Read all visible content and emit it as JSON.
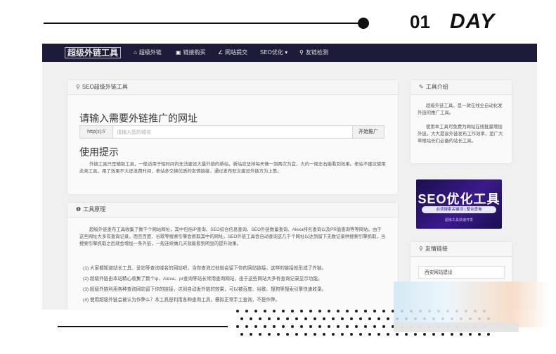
{
  "decor": {
    "number": "01",
    "day_label": "DAY"
  },
  "colors": {
    "navbar": "#1c1c3a",
    "banner": "#2a1670",
    "page_bg": "#f0f0f0"
  },
  "nav": {
    "brand": "超级外链工具",
    "items": [
      {
        "label": "超级外链",
        "icon": "home-icon"
      },
      {
        "label": "链接购买",
        "icon": "calendar-icon"
      },
      {
        "label": "网站提交",
        "icon": "chart-icon"
      },
      {
        "label": "SEO优化 ▾",
        "icon": ""
      },
      {
        "label": "友链检测",
        "icon": "link-icon"
      }
    ]
  },
  "main_panel": {
    "header": "SEO超级外链工具",
    "heading": "请输入需要外链推广的网址",
    "prefix": "http(s)://",
    "url_placeholder": "请输入您的域名",
    "submit_label": "开始推广",
    "tips_heading": "使用提示",
    "tips_text": "外链工具只是辅助工具，一般适用于短时间内无法建设大量外链的新站，新站应坚持每天做一到两次为宜，大约一周左右能看到效果。老站不建议使用此类工具，用了效果不大还浪费时间，老站多交换优质的友情链接，通过发布软文建设外链方为上策。"
  },
  "principle_panel": {
    "header": "工具原理",
    "intro": "超级外链发布工具收集了数千个网站网址，其中包括IP查询、SEO综合信息查询、SEO外链数量查询、Alexa排名查询以及PR值查询等等网站。由于这些网址大多有查询记录，而且百度、谷歌等搜索引擎会抓取其中的网址。SEO外链工具会自动查询这几千个网址以达到留下无数记录供搜索引擎抓取，当搜索引擎抓取之后就会增加一条外链，一般连续做几天就能看到明显的提升效果。",
    "items": [
      "(1)  大家都知道站长工具、爱站等查询域名的网站吧，当你查询过他就会留下你的网站链接，这样的链接就形成了外链。",
      "(2)  超级外链由本站精心收集了数个ip、Alexa、pr查询等站长常用查询网站，由于这些网站大多有查询记录显示功能。",
      "(3)  超级外链利用各种查询网站留下你的链接，达到自动发外链的效果，可以被百度、谷歌、搜狗等搜索引擎快速收录。",
      "(4)  使用超级外链会被认为作弊么？本工具是利用各种查询工具，模拟正常手工查询，不是作弊。"
    ]
  },
  "sidebar": {
    "intro_header": "工具介绍",
    "intro_text_1": "超级外链工具，是一款在线全自动化发外链的推广工具。",
    "intro_text_2": "使用本工具可免费为网站在线批量增加外链，大大提高外链发布工作效率，是广大草根站长们必备的站长工具。",
    "banner_title": "SEO优化工具",
    "banner_subtitle": "必须搜索关键词 | 整合查询",
    "banner_small": "超级工具快速开发",
    "links_header": "友情链接",
    "links": [
      "西安网站建设"
    ]
  }
}
